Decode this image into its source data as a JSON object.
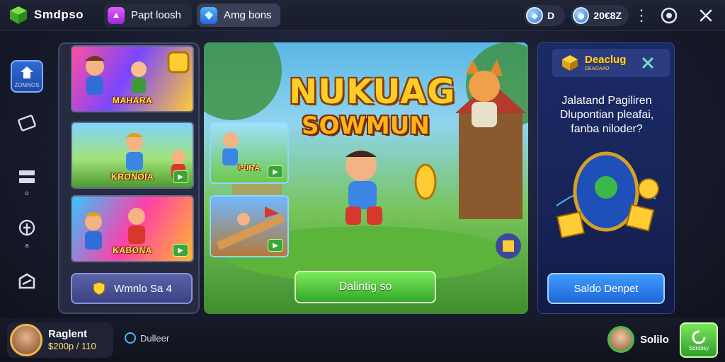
{
  "app": {
    "title": "Smdpso"
  },
  "top_tabs": [
    {
      "label": "Papt loosh"
    },
    {
      "label": "Amg bons"
    }
  ],
  "currencies": [
    {
      "value": "D"
    },
    {
      "value": "20€8Z"
    }
  ],
  "rail": {
    "items": [
      {
        "label": "ZOMNOS"
      },
      {
        "label": ""
      },
      {
        "label": "o"
      },
      {
        "label": "a"
      },
      {
        "label": ""
      }
    ]
  },
  "left_panel": {
    "thumbs": [
      {
        "label": "MAHARA"
      },
      {
        "label": "KRONOIA"
      },
      {
        "label": "KABONA"
      }
    ],
    "button_label": "Wmnlo Sa 4"
  },
  "center_panel": {
    "title": "NUKUAG",
    "subtitle": "SOWMUN",
    "mini_cards": [
      {
        "label": "PURA"
      },
      {
        "label": ""
      }
    ],
    "button_label": "Dalintig so"
  },
  "right_panel": {
    "header_title": "Deaclug",
    "header_sub": "DEAOAAO",
    "text_lines": [
      "Jalatand Pagiliren",
      "Dlupontian pleafai,",
      "fanba niloder?"
    ],
    "button_label": "Saldo Denpet"
  },
  "bottom": {
    "profile_name": "Raglent",
    "profile_balance": "$200p / 110",
    "status_text": "Dulleer",
    "friend_name": "Solilo",
    "go_label": "Sdnbisy"
  },
  "colors": {
    "accent_green": "#33a82a",
    "accent_blue": "#1f66d8",
    "title_gold": "#ffcd2a"
  }
}
